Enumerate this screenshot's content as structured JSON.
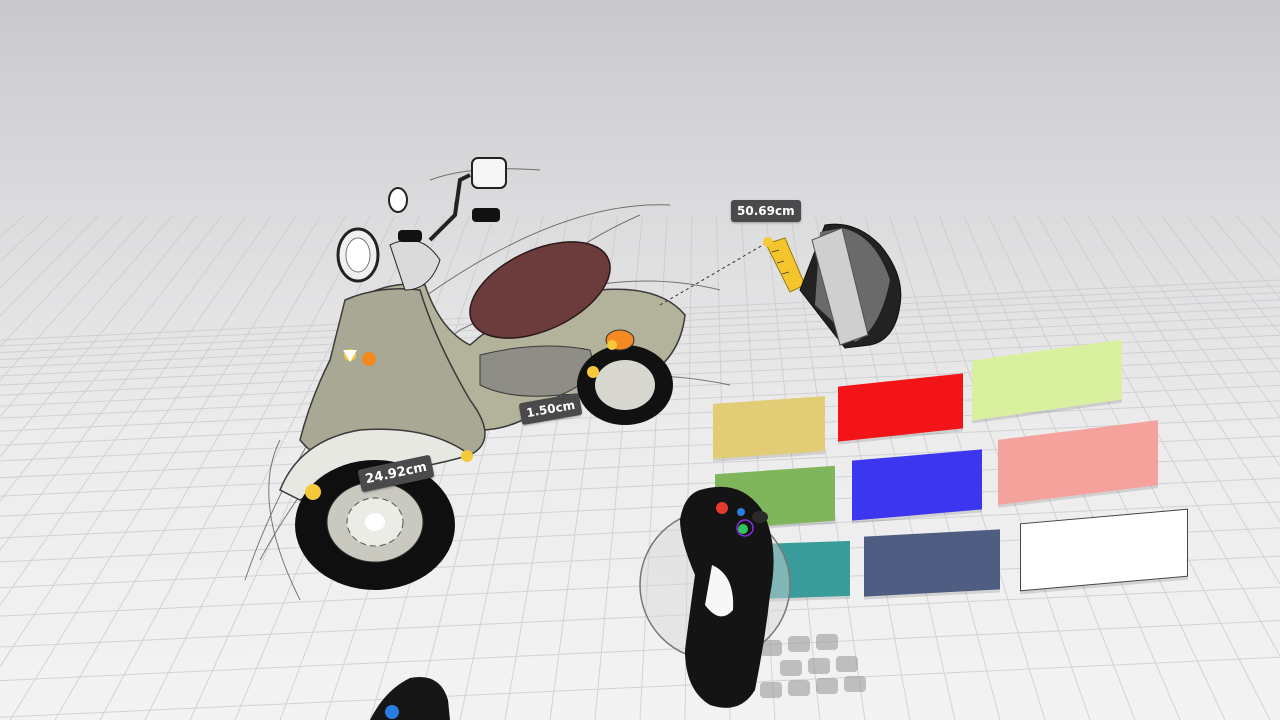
{
  "measurements": {
    "tape_length": "50.69cm",
    "body_length": "1.50cm",
    "wheel_width": "24.92cm"
  },
  "color_palette": {
    "swatches": [
      {
        "name": "mustard",
        "color": "#e3cc76"
      },
      {
        "name": "red",
        "color": "#f21417"
      },
      {
        "name": "light-lime",
        "color": "#d9f09e"
      },
      {
        "name": "green",
        "color": "#7fb55b"
      },
      {
        "name": "blue",
        "color": "#3c37ee"
      },
      {
        "name": "salmon",
        "color": "#f6a29c"
      },
      {
        "name": "teal",
        "color": "#3a9c9a"
      },
      {
        "name": "slate-blue",
        "color": "#4f5d82"
      },
      {
        "name": "white",
        "color": "#ffffff"
      }
    ]
  },
  "colors": {
    "background": "#dcdcde",
    "grid": "#c7c7ca",
    "label_bg": "#4a4a4c",
    "handle_yellow": "#f6c93a",
    "handle_orange": "#f28a1e",
    "scooter_body": "#b7b79e",
    "scooter_seat": "#6c3b3b",
    "controller": "#151515"
  },
  "icons": {
    "tape_measure": "tape-measure-icon",
    "controller": "vr-controller-icon"
  }
}
